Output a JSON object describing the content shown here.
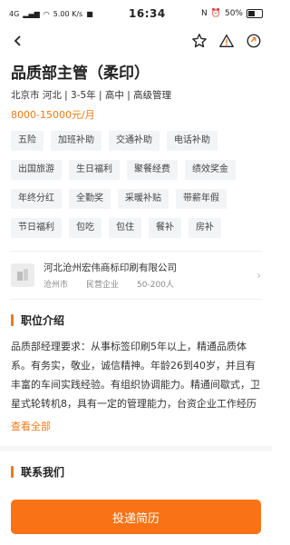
{
  "status_bar": {
    "network": "4G",
    "speed": "5.00 K/s",
    "time": "16:34",
    "battery": "50%"
  },
  "nav": {
    "back_icon": "chevron-left-icon",
    "favorite_icon": "star-outline-icon",
    "report_icon": "warning-triangle-icon",
    "share_icon": "refresh-share-icon"
  },
  "job": {
    "title": "品质部主管（柔印）",
    "meta": "北京市 河北 | 3-5年 | 高中 | 高级管理",
    "salary": "8000-15000元/月"
  },
  "tags": [
    "五险",
    "加班补助",
    "交通补助",
    "电话补助",
    "出国旅游",
    "生日福利",
    "聚餐经费",
    "绩效奖金",
    "年终分红",
    "全勤奖",
    "采暖补贴",
    "带薪年假",
    "节日福利",
    "包吃",
    "包住",
    "餐补",
    "房补"
  ],
  "company": {
    "name": "河北沧州宏伟商标印刷有限公司",
    "city": "沧州市",
    "type": "民营企业",
    "size": "50-200人"
  },
  "section_intro": {
    "title": "职位介绍",
    "description": "品质部经理要求：从事标签印刷5年以上，精通品质体系。有务实，敬业，诚信精神。年龄26到40岁，并且有丰富的车间实践经验。有组织协调能力。精通间歇式，卫星式轮转机8，具有一定的管理能力，台资企业工作经历",
    "more": "查看全部"
  },
  "section_contact": {
    "title": "联系我们"
  },
  "apply_button": "投递简历",
  "colors": {
    "accent": "#f97316",
    "salary": "#f07a17"
  }
}
